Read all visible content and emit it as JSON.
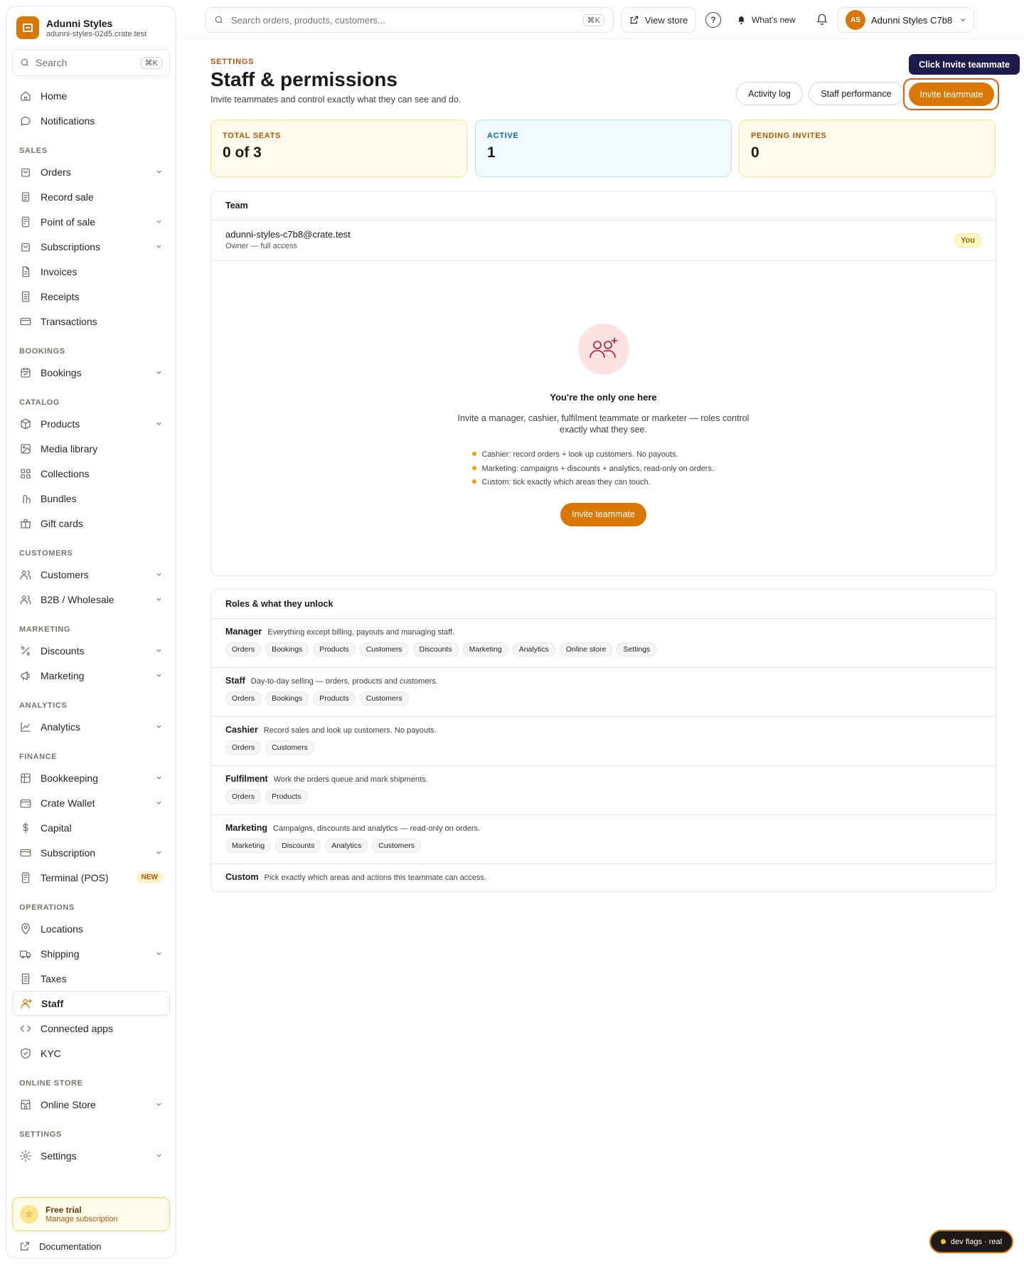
{
  "brand": {
    "name": "Adunni Styles",
    "host": "adunni-styles-02d5.crate.test"
  },
  "sidebar": {
    "search_placeholder": "Search",
    "search_kbd": "⌘K",
    "top_items": [
      {
        "label": "Home",
        "icon": "home-icon"
      },
      {
        "label": "Notifications",
        "icon": "chat-bubble-icon"
      }
    ],
    "sections": [
      {
        "label": "SALES",
        "items": [
          {
            "label": "Orders",
            "icon": "bag-icon",
            "expandable": true
          },
          {
            "label": "Record sale",
            "icon": "clipboard-icon",
            "expandable": false
          },
          {
            "label": "Point of sale",
            "icon": "terminal-icon",
            "expandable": true
          },
          {
            "label": "Subscriptions",
            "icon": "repeat-bag-icon",
            "expandable": true
          },
          {
            "label": "Invoices",
            "icon": "document-icon",
            "expandable": false
          },
          {
            "label": "Receipts",
            "icon": "receipt-icon",
            "expandable": false
          },
          {
            "label": "Transactions",
            "icon": "card-icon",
            "expandable": false
          }
        ]
      },
      {
        "label": "BOOKINGS",
        "items": [
          {
            "label": "Bookings",
            "icon": "calendar-icon",
            "expandable": true
          }
        ]
      },
      {
        "label": "CATALOG",
        "items": [
          {
            "label": "Products",
            "icon": "box-icon",
            "expandable": true
          },
          {
            "label": "Media library",
            "icon": "image-icon",
            "expandable": false
          },
          {
            "label": "Collections",
            "icon": "grid-icon",
            "expandable": false
          },
          {
            "label": "Bundles",
            "icon": "bundle-icon",
            "expandable": false
          },
          {
            "label": "Gift cards",
            "icon": "gift-icon",
            "expandable": false
          }
        ]
      },
      {
        "label": "CUSTOMERS",
        "items": [
          {
            "label": "Customers",
            "icon": "users-icon",
            "expandable": true
          },
          {
            "label": "B2B / Wholesale",
            "icon": "users-icon",
            "expandable": true
          }
        ]
      },
      {
        "label": "MARKETING",
        "items": [
          {
            "label": "Discounts",
            "icon": "percent-icon",
            "expandable": true
          },
          {
            "label": "Marketing",
            "icon": "megaphone-icon",
            "expandable": true
          }
        ]
      },
      {
        "label": "ANALYTICS",
        "items": [
          {
            "label": "Analytics",
            "icon": "chart-icon",
            "expandable": true
          }
        ]
      },
      {
        "label": "FINANCE",
        "items": [
          {
            "label": "Bookkeeping",
            "icon": "ledger-icon",
            "expandable": true
          },
          {
            "label": "Crate Wallet",
            "icon": "wallet-icon",
            "expandable": true
          },
          {
            "label": "Capital",
            "icon": "dollar-icon",
            "expandable": false
          },
          {
            "label": "Subscription",
            "icon": "card-icon",
            "expandable": true
          },
          {
            "label": "Terminal (POS)",
            "icon": "terminal-icon",
            "expandable": false,
            "badge": "NEW"
          }
        ]
      },
      {
        "label": "OPERATIONS",
        "items": [
          {
            "label": "Locations",
            "icon": "pin-icon",
            "expandable": false
          },
          {
            "label": "Shipping",
            "icon": "truck-icon",
            "expandable": true
          },
          {
            "label": "Taxes",
            "icon": "receipt-icon",
            "expandable": false
          },
          {
            "label": "Staff",
            "icon": "user-plus-icon",
            "expandable": false,
            "active": true
          },
          {
            "label": "Connected apps",
            "icon": "code-icon",
            "expandable": false
          },
          {
            "label": "KYC",
            "icon": "shield-icon",
            "expandable": false
          }
        ]
      },
      {
        "label": "ONLINE STORE",
        "items": [
          {
            "label": "Online Store",
            "icon": "store-icon",
            "expandable": true
          }
        ]
      },
      {
        "label": "SETTINGS",
        "items": [
          {
            "label": "Settings",
            "icon": "gear-icon",
            "expandable": true
          }
        ]
      }
    ],
    "trial": {
      "title": "Free trial",
      "subtitle": "Manage subscription"
    },
    "documentation": "Documentation"
  },
  "topbar": {
    "search_placeholder": "Search orders, products, customers...",
    "search_kbd": "⌘K",
    "view_store": "View store",
    "whats_new": "What's new",
    "account_initials": "AS",
    "account_name": "Adunni Styles C7b8"
  },
  "page": {
    "eyebrow": "SETTINGS",
    "title": "Staff & permissions",
    "subtitle": "Invite teammates and control exactly what they can see and do.",
    "buttons": {
      "activity_log": "Activity log",
      "staff_performance": "Staff performance",
      "invite": "Invite teammate"
    },
    "coach_tip": "Click Invite teammate"
  },
  "stats": [
    {
      "label": "TOTAL SEATS",
      "value": "0 of 3"
    },
    {
      "label": "ACTIVE",
      "value": "1"
    },
    {
      "label": "PENDING INVITES",
      "value": "0"
    }
  ],
  "team": {
    "title": "Team",
    "member": {
      "email": "adunni-styles-c7b8@crate.test",
      "role": "Owner — full access",
      "badge": "You"
    },
    "empty": {
      "title": "You're the only one here",
      "description": "Invite a manager, cashier, fulfilment teammate or marketer — roles control exactly what they see.",
      "bullets": [
        "Cashier: record orders + look up customers. No payouts.",
        "Marketing: campaigns + discounts + analytics, read-only on orders.",
        "Custom: tick exactly which areas they can touch."
      ],
      "button": "Invite teammate"
    }
  },
  "roles": {
    "title": "Roles & what they unlock",
    "items": [
      {
        "name": "Manager",
        "desc": "Everything except billing, payouts and managing staff.",
        "tags": [
          "Orders",
          "Bookings",
          "Products",
          "Customers",
          "Discounts",
          "Marketing",
          "Analytics",
          "Online store",
          "Settings"
        ]
      },
      {
        "name": "Staff",
        "desc": "Day-to-day selling — orders, products and customers.",
        "tags": [
          "Orders",
          "Bookings",
          "Products",
          "Customers"
        ]
      },
      {
        "name": "Cashier",
        "desc": "Record sales and look up customers. No payouts.",
        "tags": [
          "Orders",
          "Customers"
        ]
      },
      {
        "name": "Fulfilment",
        "desc": "Work the orders queue and mark shipments.",
        "tags": [
          "Orders",
          "Products"
        ]
      },
      {
        "name": "Marketing",
        "desc": "Campaigns, discounts and analytics — read-only on orders.",
        "tags": [
          "Marketing",
          "Discounts",
          "Analytics",
          "Customers"
        ]
      },
      {
        "name": "Custom",
        "desc": "Pick exactly which areas and actions this teammate can access.",
        "tags": []
      }
    ]
  },
  "dev_flags": "dev flags · real",
  "colors": {
    "accent": "#d97706",
    "coach_tip_bg": "#1e1b4b",
    "highlight_ring": "#ea580c"
  }
}
